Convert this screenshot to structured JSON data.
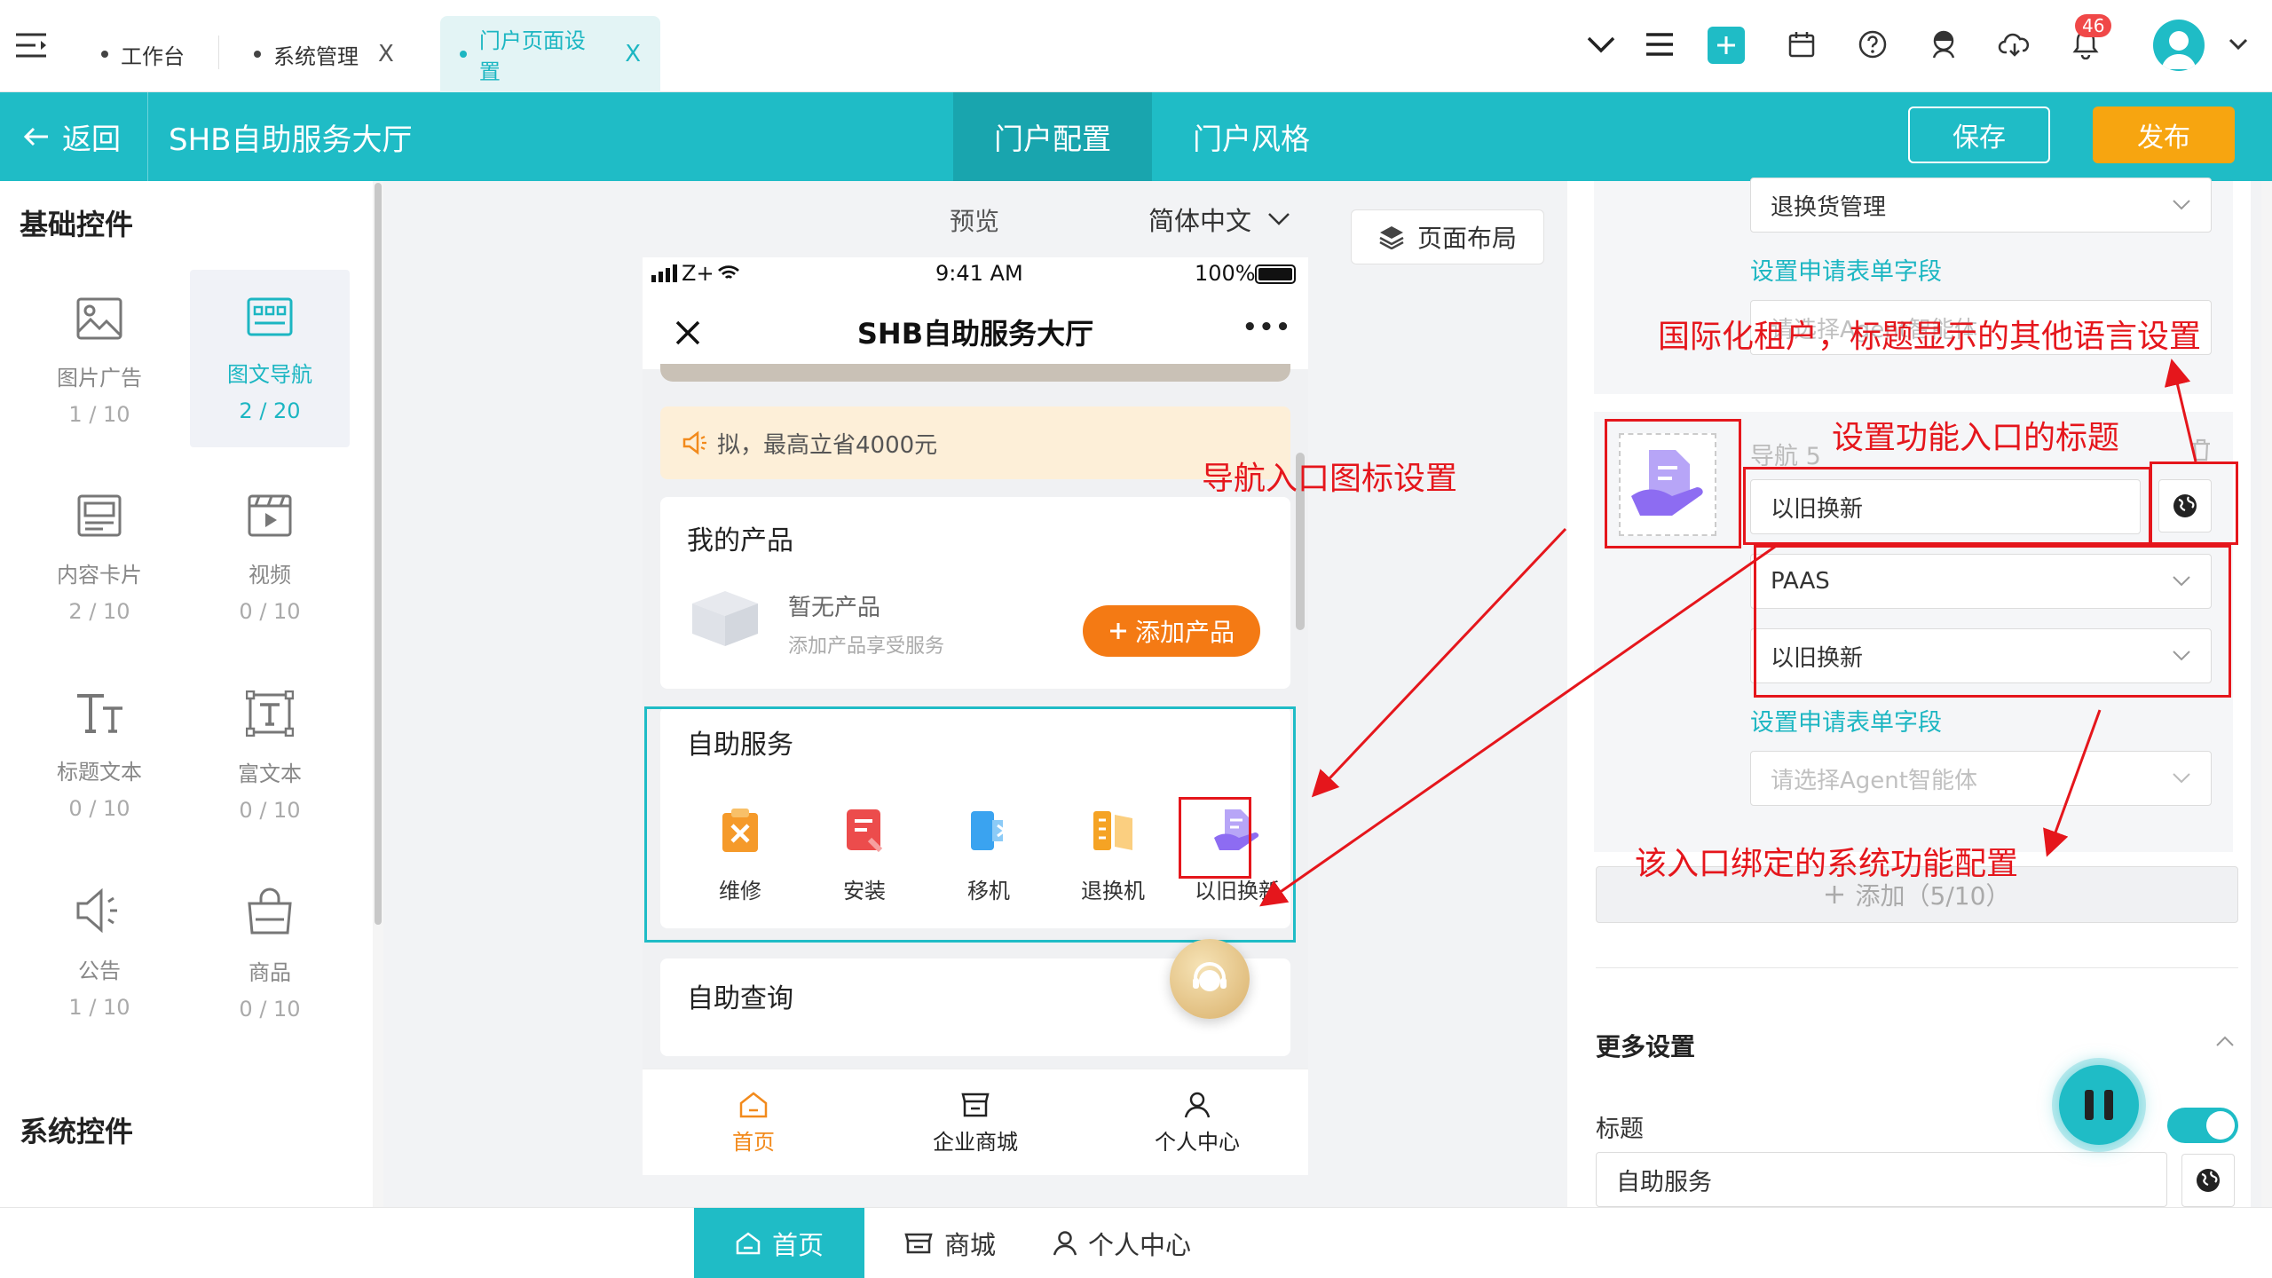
{
  "tabs": [
    {
      "label": "工作台"
    },
    {
      "label": "系统管理",
      "close": "X"
    },
    {
      "label": "门户页面设置",
      "close": "X"
    }
  ],
  "toolbar": {
    "notification_count": "46"
  },
  "header": {
    "back_label": "返回",
    "title": "SHB自助服务大厅",
    "tab_config": "门户配置",
    "tab_style": "门户风格",
    "save_label": "保存",
    "publish_label": "发布"
  },
  "left": {
    "basic_title": "基础控件",
    "system_title": "系统控件",
    "components": [
      {
        "label": "图片广告",
        "count": "1 / 10"
      },
      {
        "label": "图文导航",
        "count": "2 / 20"
      },
      {
        "label": "内容卡片",
        "count": "2 / 10"
      },
      {
        "label": "视频",
        "count": "0 / 10"
      },
      {
        "label": "标题文本",
        "count": "0 / 10"
      },
      {
        "label": "富文本",
        "count": "0 / 10"
      },
      {
        "label": "公告",
        "count": "1 / 10"
      },
      {
        "label": "商品",
        "count": "0 / 10"
      }
    ]
  },
  "center": {
    "preview_label": "预览",
    "language": "简体中文",
    "layout_button": "页面布局"
  },
  "phone": {
    "carrier": "Z+",
    "time": "9:41 AM",
    "battery": "100%",
    "title": "SHB自助服务大厅",
    "more": "•••",
    "notice": "拟，最高立省4000元",
    "products_title": "我的产品",
    "no_product": "暂无产品",
    "no_product_sub": "添加产品享受服务",
    "add_product": "添加产品",
    "self_service_title": "自助服务",
    "services": [
      {
        "label": "维修",
        "color": "#f59a2a"
      },
      {
        "label": "安装",
        "color": "#ec4c4c"
      },
      {
        "label": "移机",
        "color": "#3aa3f0"
      },
      {
        "label": "退换机",
        "color": "#f5a324"
      },
      {
        "label": "以旧换新",
        "color": "#8d6cf2"
      }
    ],
    "query_title": "自助查询",
    "tabbar": [
      "首页",
      "企业商城",
      "个人中心"
    ]
  },
  "bottom_tabs": [
    "首页",
    "商城",
    "个人中心"
  ],
  "right": {
    "select_return": "退换货管理",
    "link_form_1": "设置申请表单字段",
    "partial_placeholder": "请选择Agent智能体",
    "nav_label": "导航 5",
    "title_value": "以旧换新",
    "select_system": "PAAS",
    "select_function": "以旧换新",
    "link_form_2": "设置申请表单字段",
    "agent_placeholder": "请选择Agent智能体",
    "add_label": "添加（5/10）",
    "more_settings": "更多设置",
    "title_label": "标题",
    "title_input": "自助服务"
  },
  "annotations": {
    "i18n": "国际化租户，标题显示的其他语言设置",
    "set_title": "设置功能入口的标题",
    "icon_setting": "导航入口图标设置",
    "binding": "该入口绑定的系统功能配置"
  },
  "colors": {
    "teal": "#1fbcc6",
    "orange": "#f7a510",
    "annotation": "#e5161c"
  }
}
